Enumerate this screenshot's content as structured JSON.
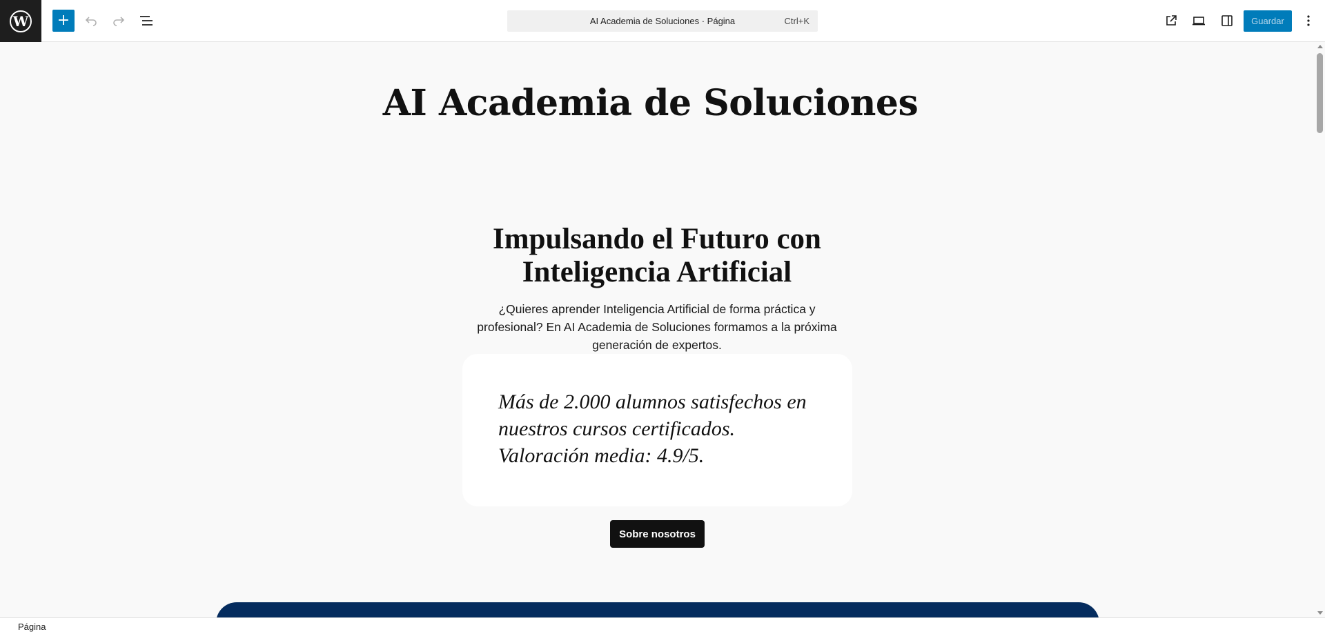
{
  "toolbar": {
    "inserter_label": "+",
    "document_title": "AI Academia de Soluciones · Página",
    "shortcut": "Ctrl+K",
    "save_label": "Guardar"
  },
  "icons": {
    "logo": "wordpress-icon",
    "undo": "undo-icon",
    "redo": "redo-icon",
    "list_view": "list-view-icon",
    "view": "external-view-icon",
    "device": "laptop-icon",
    "settings": "sidebar-icon",
    "options": "more-vertical-icon"
  },
  "content": {
    "site_title": "AI Academia de Soluciones",
    "hero_heading_line1": "Impulsando el Futuro con",
    "hero_heading_line2": "Inteligencia Artificial",
    "hero_text": "¿Quieres aprender Inteligencia Artificial de forma práctica y profesional? En AI Academia de Soluciones formamos a la próxima generación de expertos.",
    "quote": "Más de 2.000 alumnos satisfechos en nuestros cursos certificados. Valoración media: 4.9/5.",
    "about_button": "Sobre nosotros"
  },
  "status": {
    "breadcrumb": "Página"
  },
  "colors": {
    "accent": "#007cba",
    "cover_block": "#052c5e",
    "button_dark": "#111111"
  }
}
